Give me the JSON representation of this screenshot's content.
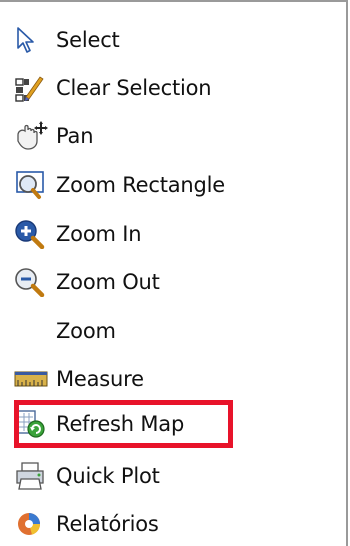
{
  "menu": {
    "items": [
      {
        "label": "Select",
        "icon": "select-arrow-icon"
      },
      {
        "label": "Clear Selection",
        "icon": "clear-selection-icon"
      },
      {
        "label": "Pan",
        "icon": "pan-hand-icon"
      },
      {
        "label": "Zoom Rectangle",
        "icon": "zoom-rectangle-icon"
      },
      {
        "label": "Zoom In",
        "icon": "zoom-in-icon"
      },
      {
        "label": "Zoom Out",
        "icon": "zoom-out-icon"
      },
      {
        "label": "Zoom",
        "icon": ""
      },
      {
        "label": "Measure",
        "icon": "measure-ruler-icon"
      },
      {
        "label": "Refresh Map",
        "icon": "refresh-map-icon"
      },
      {
        "label": "Quick Plot",
        "icon": "quick-plot-icon"
      },
      {
        "label": "Relatórios",
        "icon": "reports-icon"
      }
    ],
    "highlighted_item": "Refresh Map",
    "highlight_color": "#e8132a"
  }
}
